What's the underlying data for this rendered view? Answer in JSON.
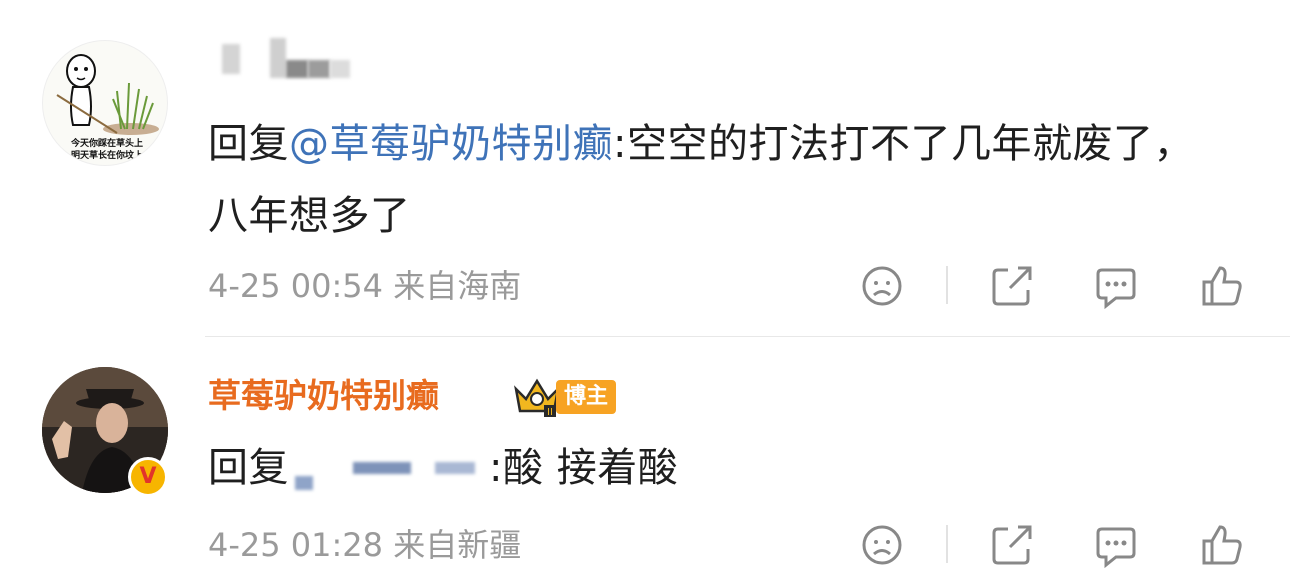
{
  "comments": [
    {
      "avatar_caption": "今天你踩在草头上\n明天草长在你坟上",
      "text_prefix": "回复",
      "mention": "@草莓驴奶特别癫",
      "text_suffix": ":空空的打法打不了几年就废了，八年想多了",
      "time": "4-25 00:54",
      "location": "来自海南"
    },
    {
      "username": "草莓驴奶特别癫",
      "role_badge": "博主",
      "verified_icon": "V",
      "text_prefix": "回复",
      "text_suffix": ":酸 接着酸",
      "time": "4-25 01:28",
      "location": "来自新疆"
    }
  ],
  "icons": {
    "dislike": "sad-face-icon",
    "share": "share-icon",
    "reply": "comment-icon",
    "like": "thumbs-up-icon"
  },
  "colors": {
    "mention": "#3f73b8",
    "username": "#e86b1f",
    "badge": "#f7a323",
    "meta": "#9a9a9a"
  }
}
